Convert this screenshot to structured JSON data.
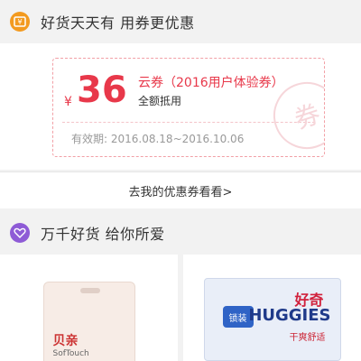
{
  "section1": {
    "title": "好货天天有 用券更优惠",
    "icon": "coupon-ticket-icon",
    "icon_color": "#f39a1f"
  },
  "coupon": {
    "currency": "¥",
    "amount": "36",
    "name": "云券（2016用户体验券）",
    "scope": "全额抵用",
    "validity": "有效期: 2016.08.18~2016.10.06",
    "stamp": "券",
    "accent_color": "#e8384a"
  },
  "more_link": {
    "label": "去我的优惠券看看>"
  },
  "section2": {
    "title": "万千好货 给你所爱",
    "icon": "heart-icon",
    "icon_color": "#8e5bd6"
  },
  "products": [
    {
      "brand": "pigeon",
      "label": "贝亲",
      "sub": "SofTouch"
    },
    {
      "brand": "huggies",
      "label_cn": "好奇",
      "label_en": "HUGGIES",
      "tag": "锁装",
      "tagline": "干爽舒适"
    }
  ]
}
